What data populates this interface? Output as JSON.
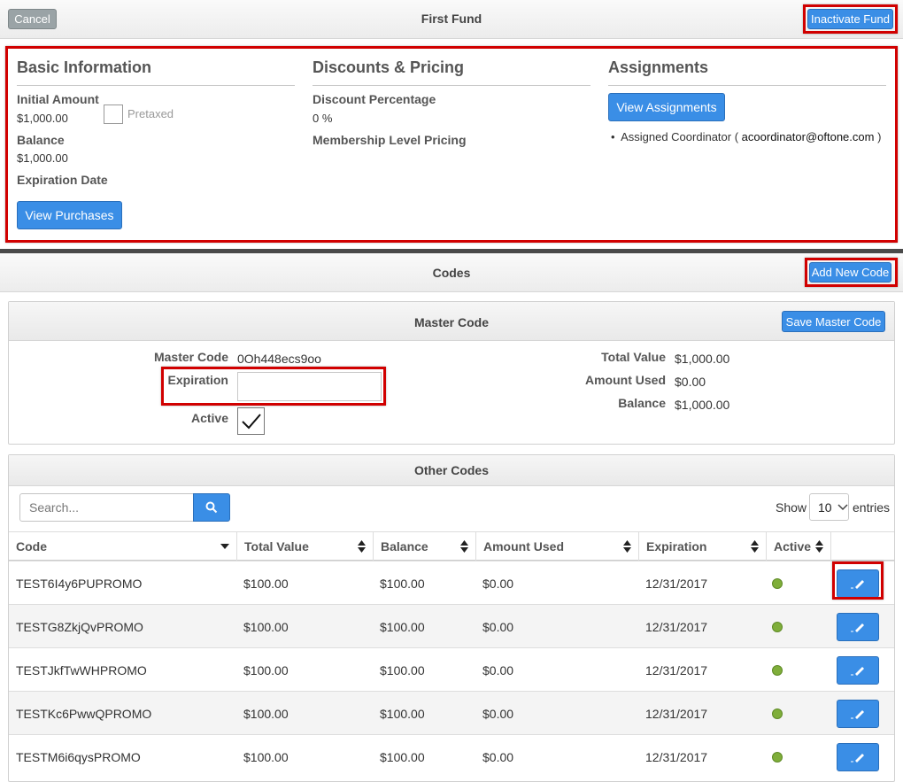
{
  "header": {
    "cancel_label": "Cancel",
    "title": "First Fund",
    "inactivate_label": "Inactivate Fund"
  },
  "basic": {
    "heading": "Basic Information",
    "initial_amount_label": "Initial Amount",
    "initial_amount_value": "$1,000.00",
    "pretaxed_label": "Pretaxed",
    "balance_label": "Balance",
    "balance_value": "$1,000.00",
    "expiration_label": "Expiration Date",
    "view_purchases_label": "View Purchases"
  },
  "discounts": {
    "heading": "Discounts & Pricing",
    "discount_label": "Discount Percentage",
    "discount_value": "0 %",
    "membership_label": "Membership Level Pricing"
  },
  "assignments": {
    "heading": "Assignments",
    "view_label": "View Assignments",
    "coordinator_prefix": "Assigned Coordinator (",
    "coordinator_email": "acoordinator@oftone.com",
    "coordinator_suffix": ")"
  },
  "codes": {
    "title": "Codes",
    "add_label": "Add New Code"
  },
  "master": {
    "title": "Master Code",
    "save_label": "Save Master Code",
    "code_label": "Master Code",
    "code_value": "0Oh448ecs9oo",
    "expiration_label": "Expiration",
    "expiration_value": "",
    "active_label": "Active",
    "active_checked": true,
    "total_label": "Total Value",
    "total_value": "$1,000.00",
    "used_label": "Amount Used",
    "used_value": "$0.00",
    "balance_label": "Balance",
    "balance_value": "$1,000.00"
  },
  "other": {
    "title": "Other Codes",
    "search_placeholder": "Search...",
    "show_label": "Show",
    "page_size": "10",
    "entries_label": "entries",
    "columns": [
      "Code",
      "Total Value",
      "Balance",
      "Amount Used",
      "Expiration",
      "Active"
    ],
    "rows": [
      {
        "code": "TEST6I4y6PUPROMO",
        "total": "$100.00",
        "balance": "$100.00",
        "used": "$0.00",
        "expiration": "12/31/2017"
      },
      {
        "code": "TESTG8ZkjQvPROMO",
        "total": "$100.00",
        "balance": "$100.00",
        "used": "$0.00",
        "expiration": "12/31/2017"
      },
      {
        "code": "TESTJkfTwWHPROMO",
        "total": "$100.00",
        "balance": "$100.00",
        "used": "$0.00",
        "expiration": "12/31/2017"
      },
      {
        "code": "TESTKc6PwwQPROMO",
        "total": "$100.00",
        "balance": "$100.00",
        "used": "$0.00",
        "expiration": "12/31/2017"
      },
      {
        "code": "TESTM6i6qysPROMO",
        "total": "$100.00",
        "balance": "$100.00",
        "used": "$0.00",
        "expiration": "12/31/2017"
      }
    ]
  },
  "colors": {
    "accent": "#3a8ee6",
    "highlight": "#d10000",
    "active_dot": "#7fae3a"
  }
}
